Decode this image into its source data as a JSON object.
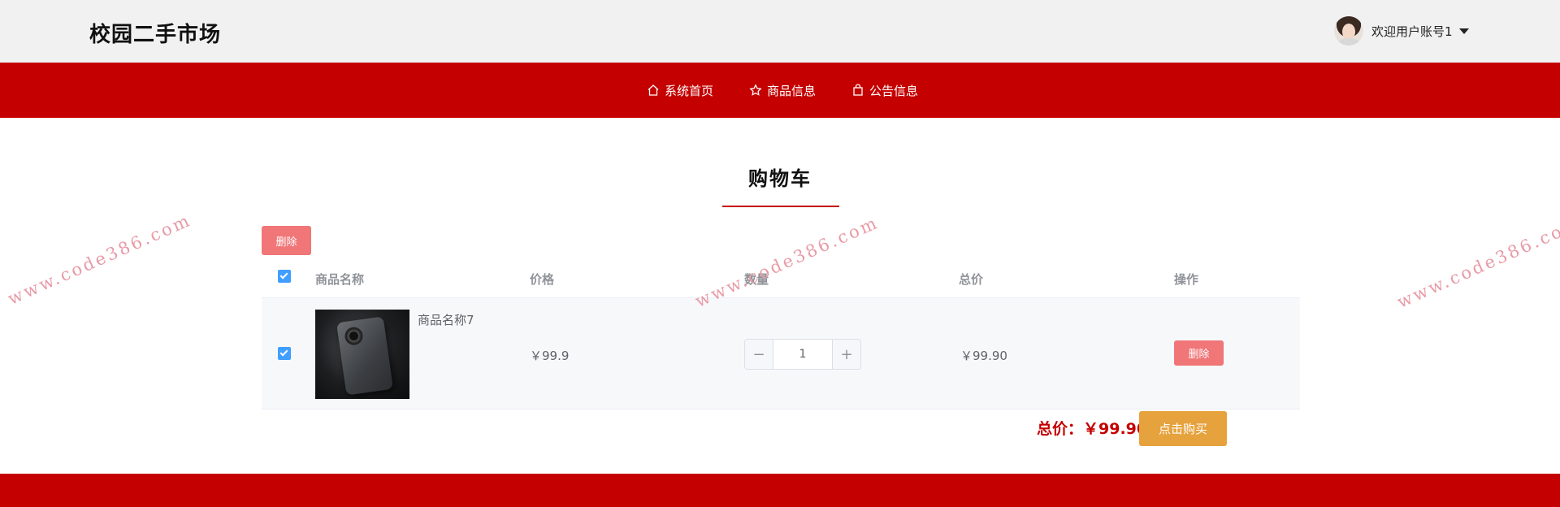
{
  "header": {
    "site_title": "校园二手市场",
    "user_name": "欢迎用户账号1"
  },
  "nav": {
    "items": [
      {
        "label": "系统首页",
        "icon": "home-icon"
      },
      {
        "label": "商品信息",
        "icon": "star-icon"
      },
      {
        "label": "公告信息",
        "icon": "bag-icon"
      }
    ]
  },
  "page": {
    "title": "购物车",
    "delete_label": "删除"
  },
  "cart": {
    "columns": [
      "商品名称",
      "价格",
      "数量",
      "总价",
      "操作"
    ],
    "all_checked": true,
    "items": [
      {
        "checked": true,
        "name": "商品名称7",
        "price": "￥99.9",
        "quantity": "1",
        "total": "￥99.90",
        "action_label": "删除"
      }
    ],
    "stepper": {
      "minus": "−",
      "plus": "+"
    },
    "total_label": "总价：￥99.90",
    "buy_label": "点击购买"
  },
  "watermark": "www.code386.com",
  "colors": {
    "brand_red": "#c40000",
    "danger_button": "#f07678",
    "buy_button": "#e6a23c",
    "checkbox": "#409eff"
  }
}
